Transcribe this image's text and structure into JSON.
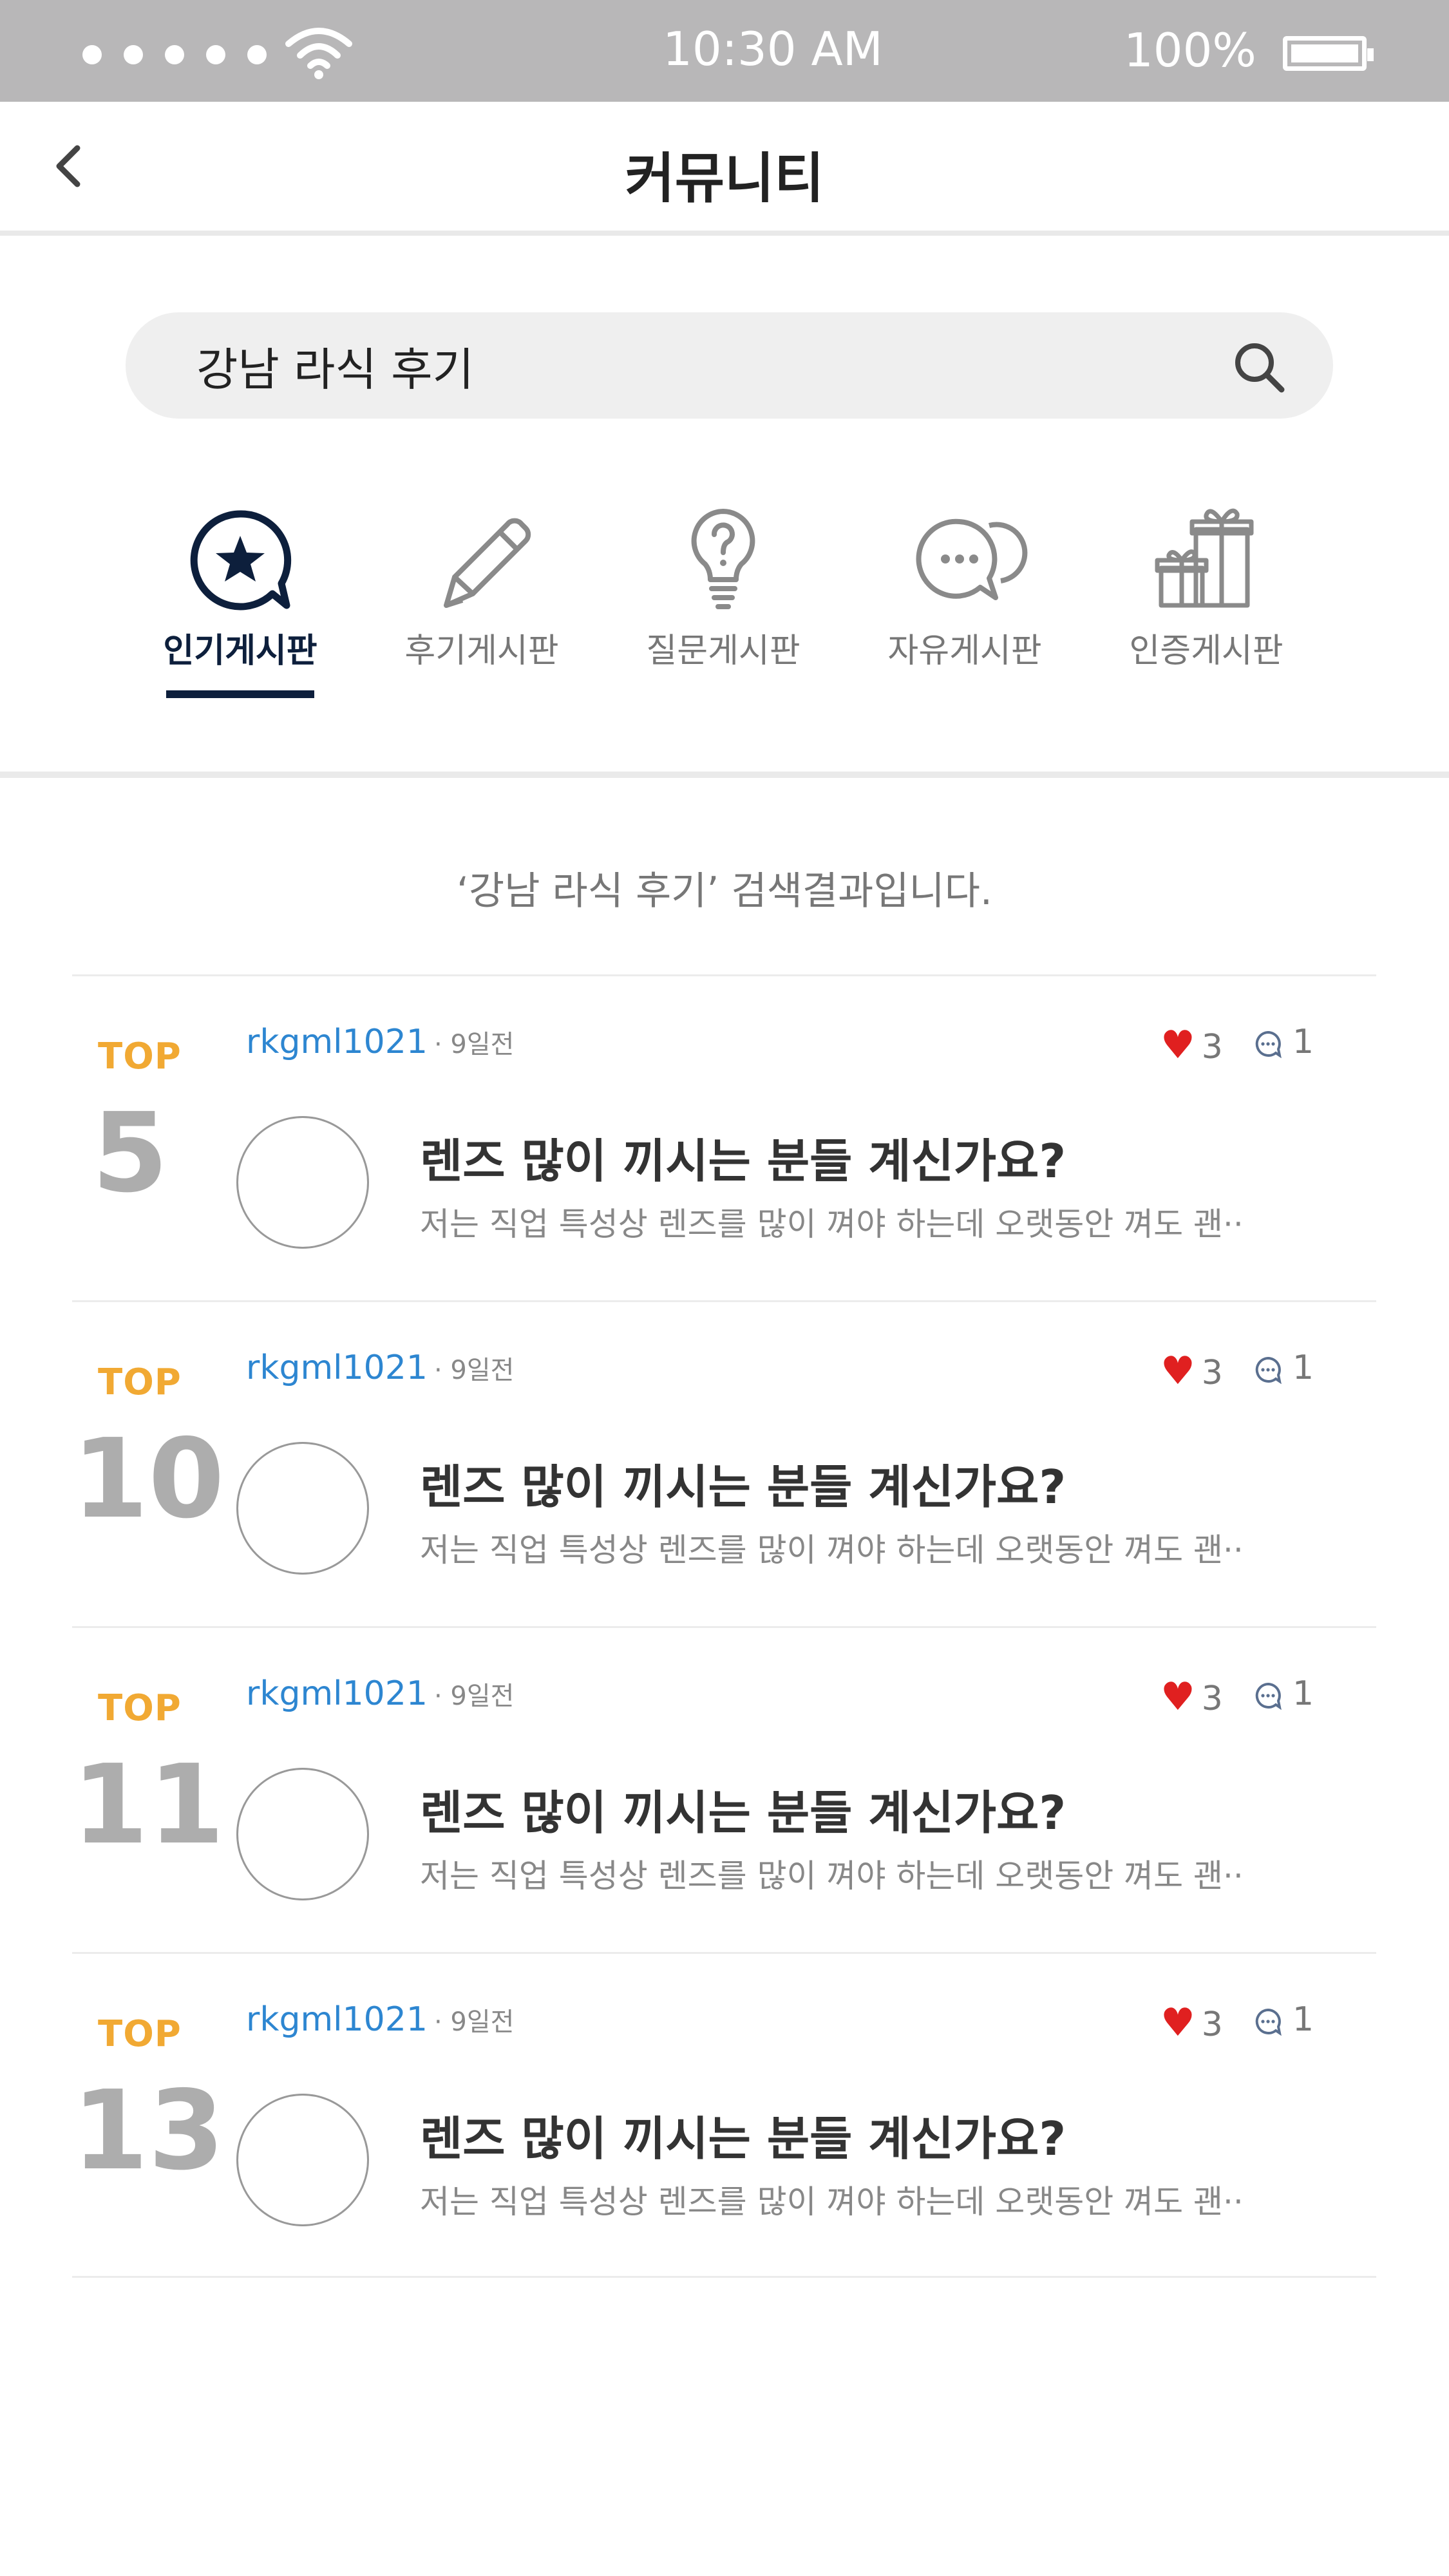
{
  "status_bar": {
    "time": "10:30 AM",
    "battery": "100%"
  },
  "header": {
    "title": "커뮤니티"
  },
  "search": {
    "value": "강남 라식 후기"
  },
  "tabs": [
    {
      "label": "인기게시판",
      "icon": "star-bubble-icon",
      "active": true
    },
    {
      "label": "후기게시판",
      "icon": "pencil-icon",
      "active": false
    },
    {
      "label": "질문게시판",
      "icon": "lightbulb-question-icon",
      "active": false
    },
    {
      "label": "자유게시판",
      "icon": "chat-bubbles-icon",
      "active": false
    },
    {
      "label": "인증게시판",
      "icon": "gift-icon",
      "active": false
    }
  ],
  "result_message": "‘강남 라식 후기’ 검색결과입니다.",
  "posts": [
    {
      "top_label": "TOP",
      "rank": "5",
      "user": "rkgml1021",
      "time": "· 9일전",
      "likes": "3",
      "comments": "1",
      "title": "렌즈 많이 끼시는 분들 계신가요?",
      "snippet": "저는 직업 특성상 렌즈를 많이 껴야 하는데 오랫동안 껴도 괜··"
    },
    {
      "top_label": "TOP",
      "rank": "10",
      "user": "rkgml1021",
      "time": "· 9일전",
      "likes": "3",
      "comments": "1",
      "title": "렌즈 많이 끼시는 분들 계신가요?",
      "snippet": "저는 직업 특성상 렌즈를 많이 껴야 하는데 오랫동안 껴도 괜··"
    },
    {
      "top_label": "TOP",
      "rank": "11",
      "user": "rkgml1021",
      "time": "· 9일전",
      "likes": "3",
      "comments": "1",
      "title": "렌즈 많이 끼시는 분들 계신가요?",
      "snippet": "저는 직업 특성상 렌즈를 많이 껴야 하는데 오랫동안 껴도 괜··"
    },
    {
      "top_label": "TOP",
      "rank": "13",
      "user": "rkgml1021",
      "time": "· 9일전",
      "likes": "3",
      "comments": "1",
      "title": "렌즈 많이 끼시는 분들 계신가요?",
      "snippet": "저는 직업 특성상 렌즈를 많이 껴야 하는데 오랫동안 껴도 괜··"
    }
  ],
  "colors": {
    "accent_navy": "#0d1f3c",
    "top_label": "#f1a933",
    "username": "#2d86d1",
    "heart": "#e02020",
    "status_bar": "#b8b7b8"
  }
}
